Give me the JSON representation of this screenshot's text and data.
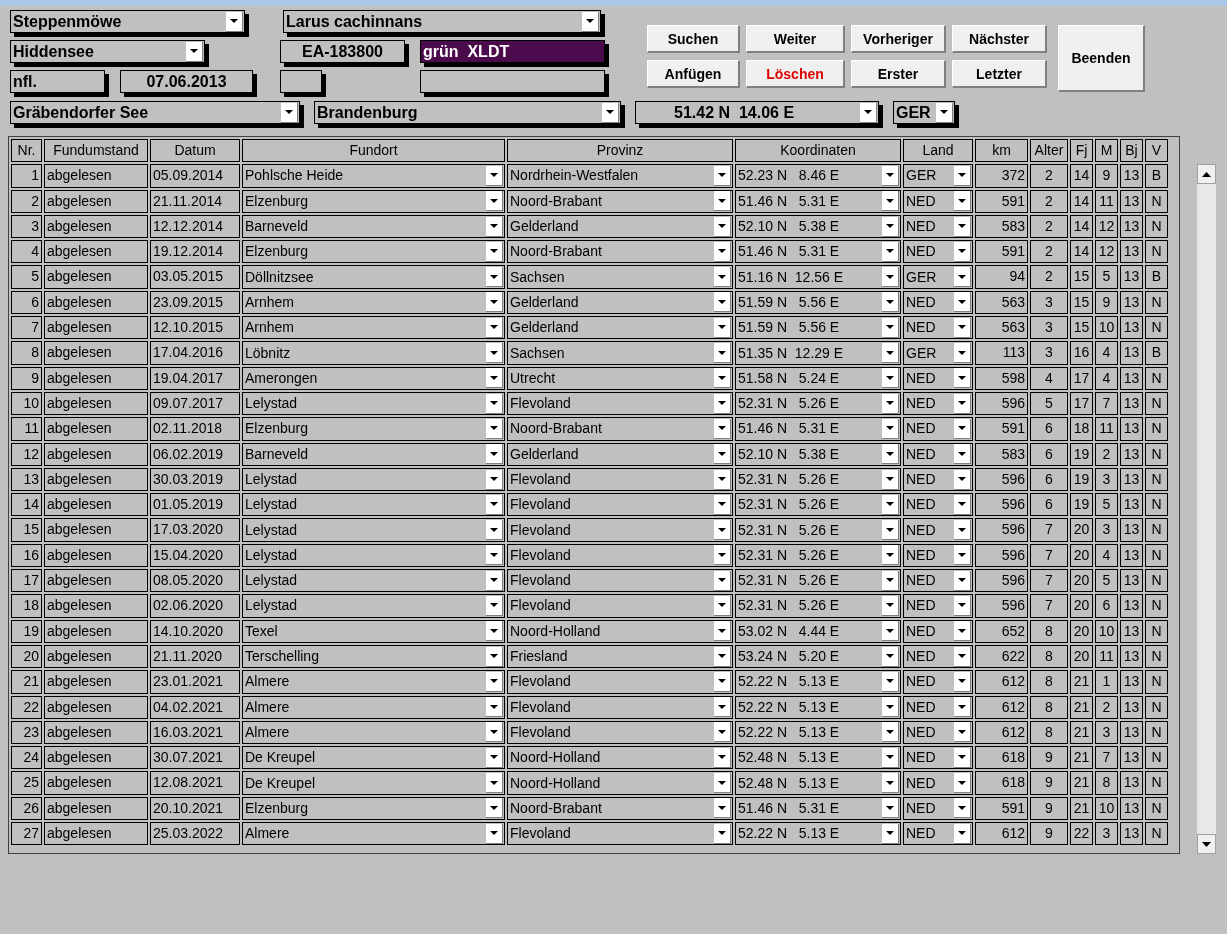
{
  "form_rows": [
    [
      {
        "kind": "combo",
        "value": "Steppenmöwe"
      },
      {
        "kind": "combo",
        "value": "Larus cachinnans"
      }
    ],
    [
      {
        "kind": "combo",
        "value": "Hiddensee"
      },
      {
        "kind": "text",
        "value": "EA-183800"
      },
      {
        "kind": "dark",
        "value": "grün  XLDT"
      }
    ],
    [
      {
        "kind": "text",
        "value": "nfl."
      },
      {
        "kind": "text",
        "value": "07.06.2013"
      },
      {
        "kind": "text"
      },
      {
        "kind": "text"
      }
    ]
  ],
  "location_row": [
    {
      "kind": "combo",
      "value": "Gräbendorfer See"
    },
    {
      "kind": "combo",
      "value": "Brandenburg"
    },
    {
      "kind": "combo",
      "value": "51.42 N  14.06 E"
    },
    {
      "kind": "combo",
      "value": "GER"
    }
  ],
  "buttons": [
    {
      "label": "Suchen",
      "kind": "normal"
    },
    {
      "label": "Weiter",
      "kind": "normal"
    },
    {
      "label": "Vorheriger",
      "kind": "normal"
    },
    {
      "label": "Nächster",
      "kind": "normal"
    },
    {
      "label": "Beenden",
      "kind": "large"
    },
    {
      "label": "Anfügen",
      "kind": "normal"
    },
    {
      "label": "Löschen",
      "kind": "delete"
    },
    {
      "label": "Erster",
      "kind": "normal"
    },
    {
      "label": "Letzter",
      "kind": "normal"
    }
  ],
  "table": {
    "columns": [
      {
        "label": "Nr.",
        "kind": "number"
      },
      {
        "label": "Fundumstand",
        "kind": "text"
      },
      {
        "label": "Datum",
        "kind": "text"
      },
      {
        "label": "Fundort",
        "kind": "combo"
      },
      {
        "label": "Provinz",
        "kind": "combo"
      },
      {
        "label": "Koordinaten",
        "kind": "combo"
      },
      {
        "label": "Land",
        "kind": "combo"
      },
      {
        "label": "km",
        "kind": "number"
      },
      {
        "label": "Alter",
        "kind": "center"
      },
      {
        "label": "Fj",
        "kind": "center"
      },
      {
        "label": "M",
        "kind": "center"
      },
      {
        "label": "Bj",
        "kind": "center"
      },
      {
        "label": "V",
        "kind": "center"
      }
    ],
    "rows": [
      [
        "1",
        "abgelesen",
        "05.09.2014",
        "Pohlsche Heide",
        "Nordrhein-Westfalen",
        "52.23 N   8.46 E",
        "GER",
        "372",
        "2",
        "14",
        "9",
        "13",
        "B"
      ],
      [
        "2",
        "abgelesen",
        "21.11.2014",
        "Elzenburg",
        "Noord-Brabant",
        "51.46 N   5.31 E",
        "NED",
        "591",
        "2",
        "14",
        "11",
        "13",
        "N"
      ],
      [
        "3",
        "abgelesen",
        "12.12.2014",
        "Barneveld",
        "Gelderland",
        "52.10 N   5.38 E",
        "NED",
        "583",
        "2",
        "14",
        "12",
        "13",
        "N"
      ],
      [
        "4",
        "abgelesen",
        "19.12.2014",
        "Elzenburg",
        "Noord-Brabant",
        "51.46 N   5.31 E",
        "NED",
        "591",
        "2",
        "14",
        "12",
        "13",
        "N"
      ],
      [
        "5",
        "abgelesen",
        "03.05.2015",
        "Döllnitzsee",
        "Sachsen",
        "51.16 N  12.56 E",
        "GER",
        "94",
        "2",
        "15",
        "5",
        "13",
        "B"
      ],
      [
        "6",
        "abgelesen",
        "23.09.2015",
        "Arnhem",
        "Gelderland",
        "51.59 N   5.56 E",
        "NED",
        "563",
        "3",
        "15",
        "9",
        "13",
        "N"
      ],
      [
        "7",
        "abgelesen",
        "12.10.2015",
        "Arnhem",
        "Gelderland",
        "51.59 N   5.56 E",
        "NED",
        "563",
        "3",
        "15",
        "10",
        "13",
        "N"
      ],
      [
        "8",
        "abgelesen",
        "17.04.2016",
        "Löbnitz",
        "Sachsen",
        "51.35 N  12.29 E",
        "GER",
        "113",
        "3",
        "16",
        "4",
        "13",
        "B"
      ],
      [
        "9",
        "abgelesen",
        "19.04.2017",
        "Amerongen",
        "Utrecht",
        "51.58 N   5.24 E",
        "NED",
        "598",
        "4",
        "17",
        "4",
        "13",
        "N"
      ],
      [
        "10",
        "abgelesen",
        "09.07.2017",
        "Lelystad",
        "Flevoland",
        "52.31 N   5.26 E",
        "NED",
        "596",
        "5",
        "17",
        "7",
        "13",
        "N"
      ],
      [
        "11",
        "abgelesen",
        "02.11.2018",
        "Elzenburg",
        "Noord-Brabant",
        "51.46 N   5.31 E",
        "NED",
        "591",
        "6",
        "18",
        "11",
        "13",
        "N"
      ],
      [
        "12",
        "abgelesen",
        "06.02.2019",
        "Barneveld",
        "Gelderland",
        "52.10 N   5.38 E",
        "NED",
        "583",
        "6",
        "19",
        "2",
        "13",
        "N"
      ],
      [
        "13",
        "abgelesen",
        "30.03.2019",
        "Lelystad",
        "Flevoland",
        "52.31 N   5.26 E",
        "NED",
        "596",
        "6",
        "19",
        "3",
        "13",
        "N"
      ],
      [
        "14",
        "abgelesen",
        "01.05.2019",
        "Lelystad",
        "Flevoland",
        "52.31 N   5.26 E",
        "NED",
        "596",
        "6",
        "19",
        "5",
        "13",
        "N"
      ],
      [
        "15",
        "abgelesen",
        "17.03.2020",
        "Lelystad",
        "Flevoland",
        "52.31 N   5.26 E",
        "NED",
        "596",
        "7",
        "20",
        "3",
        "13",
        "N"
      ],
      [
        "16",
        "abgelesen",
        "15.04.2020",
        "Lelystad",
        "Flevoland",
        "52.31 N   5.26 E",
        "NED",
        "596",
        "7",
        "20",
        "4",
        "13",
        "N"
      ],
      [
        "17",
        "abgelesen",
        "08.05.2020",
        "Lelystad",
        "Flevoland",
        "52.31 N   5.26 E",
        "NED",
        "596",
        "7",
        "20",
        "5",
        "13",
        "N"
      ],
      [
        "18",
        "abgelesen",
        "02.06.2020",
        "Lelystad",
        "Flevoland",
        "52.31 N   5.26 E",
        "NED",
        "596",
        "7",
        "20",
        "6",
        "13",
        "N"
      ],
      [
        "19",
        "abgelesen",
        "14.10.2020",
        "Texel",
        "Noord-Holland",
        "53.02 N   4.44 E",
        "NED",
        "652",
        "8",
        "20",
        "10",
        "13",
        "N"
      ],
      [
        "20",
        "abgelesen",
        "21.11.2020",
        "Terschelling",
        "Friesland",
        "53.24 N   5.20 E",
        "NED",
        "622",
        "8",
        "20",
        "11",
        "13",
        "N"
      ],
      [
        "21",
        "abgelesen",
        "23.01.2021",
        "Almere",
        "Flevoland",
        "52.22 N   5.13 E",
        "NED",
        "612",
        "8",
        "21",
        "1",
        "13",
        "N"
      ],
      [
        "22",
        "abgelesen",
        "04.02.2021",
        "Almere",
        "Flevoland",
        "52.22 N   5.13 E",
        "NED",
        "612",
        "8",
        "21",
        "2",
        "13",
        "N"
      ],
      [
        "23",
        "abgelesen",
        "16.03.2021",
        "Almere",
        "Flevoland",
        "52.22 N   5.13 E",
        "NED",
        "612",
        "8",
        "21",
        "3",
        "13",
        "N"
      ],
      [
        "24",
        "abgelesen",
        "30.07.2021",
        "De Kreupel",
        "Noord-Holland",
        "52.48 N   5.13 E",
        "NED",
        "618",
        "9",
        "21",
        "7",
        "13",
        "N"
      ],
      [
        "25",
        "abgelesen",
        "12.08.2021",
        "De Kreupel",
        "Noord-Holland",
        "52.48 N   5.13 E",
        "NED",
        "618",
        "9",
        "21",
        "8",
        "13",
        "N"
      ],
      [
        "26",
        "abgelesen",
        "20.10.2021",
        "Elzenburg",
        "Noord-Brabant",
        "51.46 N   5.31 E",
        "NED",
        "591",
        "9",
        "21",
        "10",
        "13",
        "N"
      ],
      [
        "27",
        "abgelesen",
        "25.03.2022",
        "Almere",
        "Flevoland",
        "52.22 N   5.13 E",
        "NED",
        "612",
        "9",
        "22",
        "3",
        "13",
        "N"
      ]
    ]
  }
}
